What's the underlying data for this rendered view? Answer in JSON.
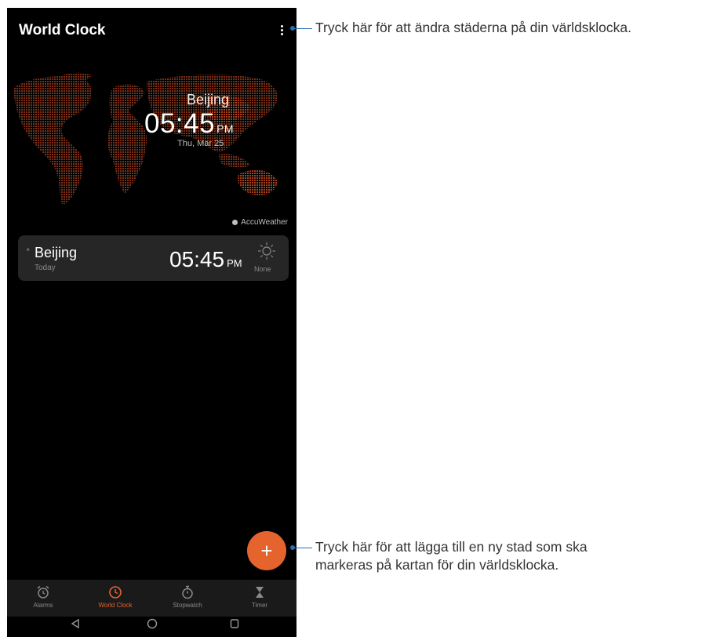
{
  "app": {
    "title": "World Clock"
  },
  "map": {
    "city": "Beijing",
    "time": "05:45",
    "ampm": "PM",
    "date": "Thu, Mar 25",
    "provider": "AccuWeather"
  },
  "city_list": [
    {
      "name": "Beijing",
      "day": "Today",
      "time": "05:45",
      "ampm": "PM",
      "weather": "None"
    }
  ],
  "fab": {
    "label": "+"
  },
  "tabs": [
    {
      "label": "Alarms",
      "icon": "alarm-clock-icon"
    },
    {
      "label": "World Clock",
      "icon": "clock-icon",
      "active": true
    },
    {
      "label": "Stopwatch",
      "icon": "stopwatch-icon"
    },
    {
      "label": "Timer",
      "icon": "hourglass-icon"
    }
  ],
  "callouts": {
    "menu": "Tryck här för att ändra städerna på din världsklocka.",
    "add_line1": "Tryck här för att lägga till en ny stad som ska",
    "add_line2": "markeras på kartan för din världsklocka."
  },
  "colors": {
    "accent": "#e5632d",
    "callout": "#2b6fb3",
    "card": "#262626"
  }
}
